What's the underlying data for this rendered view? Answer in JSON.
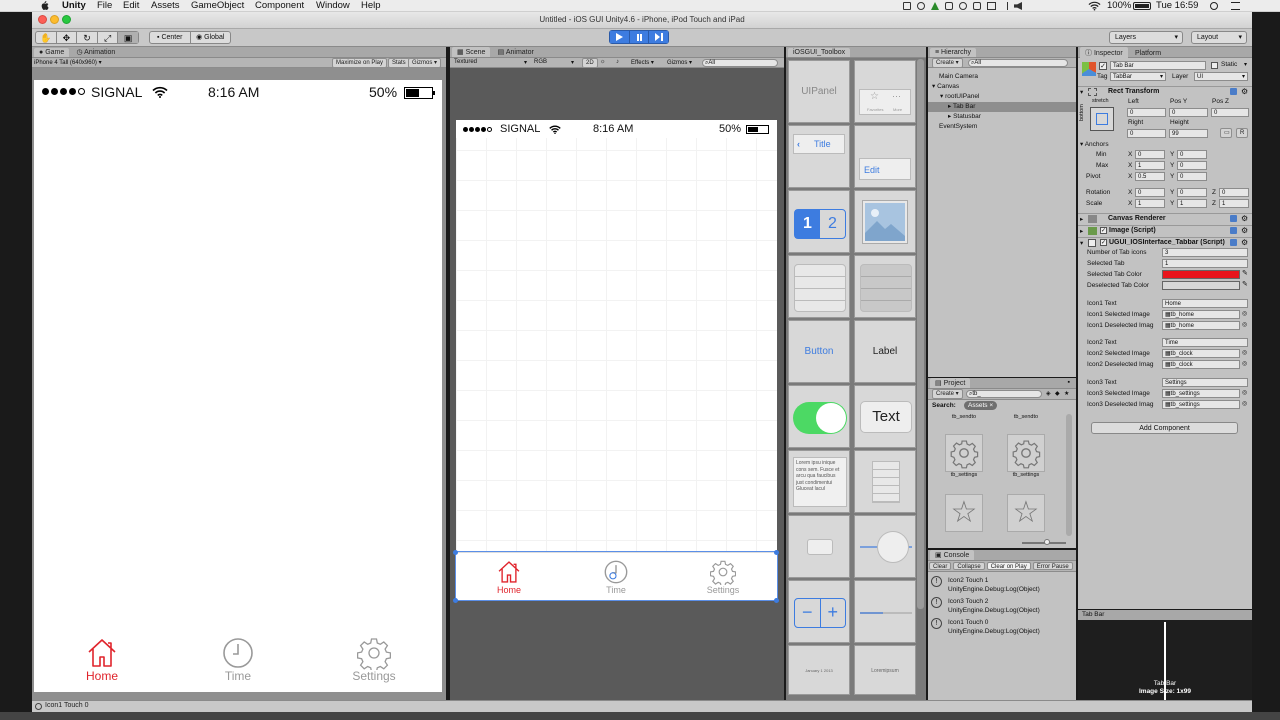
{
  "menubar": {
    "apple": "",
    "app": "Unity",
    "items": [
      "File",
      "Edit",
      "Assets",
      "GameObject",
      "Component",
      "Window",
      "Help"
    ],
    "battery": "100%",
    "clock": "Tue 16:59"
  },
  "window": {
    "title": "Untitled - iOS GUI Unity4.6 - iPhone, iPod Touch and iPad"
  },
  "toolbar": {
    "center": "Center",
    "global": "Global",
    "layers": "Layers",
    "layout": "Layout"
  },
  "game": {
    "tab_game": "Game",
    "tab_animation": "Animation",
    "aspect": "iPhone 4 Tall (640x960)",
    "maximize": "Maximize on Play",
    "stats": "Stats",
    "gizmos": "Gizmos"
  },
  "phone": {
    "signal": "SIGNAL",
    "time": "8:16 AM",
    "battery": "50%",
    "tabs": [
      "Home",
      "Time",
      "Settings"
    ]
  },
  "scene": {
    "tab_scene": "Scene",
    "tab_animator": "Animator",
    "textured": "Textured",
    "rgb": "RGB",
    "mode2d": "2D",
    "effects": "Effects",
    "gizmos": "Gizmos",
    "search": "All"
  },
  "toolbox": {
    "title": "iOSGUI_Toolbox",
    "uipanel": "UIPanel",
    "title_item": "Title",
    "edit": "Edit",
    "seg1": "1",
    "seg2": "2",
    "button": "Button",
    "label": "Label",
    "text": "Text",
    "lorem": "Lorem ipsu inique cons sem. Fusce et arcu qua faucibus just condimentui Gluceat lacul",
    "month": "January 1 2013",
    "lorem_short": "Loremipsum",
    "favorites": "Favorites",
    "more": "More"
  },
  "hierarchy": {
    "title": "Hierarchy",
    "create": "Create",
    "search": "All",
    "items": [
      "Main Camera",
      "Canvas",
      "rootUIPanel",
      "Tab Bar",
      "Statusbar",
      "EventSystem"
    ]
  },
  "project": {
    "title": "Project",
    "create": "Create",
    "search_value": "tb_",
    "search_label": "Search:",
    "assets_chip": "Assets",
    "items": [
      "tb_sendto",
      "tb_sendto",
      "tb_settings",
      "tb_settings"
    ]
  },
  "console": {
    "title": "Console",
    "buttons": [
      "Clear",
      "Collapse",
      "Clear on Play",
      "Error Pause"
    ],
    "logs": [
      {
        "line1": "Icon2 Touch 1",
        "line2": "UnityEngine.Debug:Log(Object)"
      },
      {
        "line1": "Icon3 Touch 2",
        "line2": "UnityEngine.Debug:Log(Object)"
      },
      {
        "line1": "Icon1 Touch 0",
        "line2": "UnityEngine.Debug:Log(Object)"
      }
    ]
  },
  "inspector": {
    "tab_inspector": "Inspector",
    "tab_platform": "Platform",
    "name": "Tab Bar",
    "static": "Static",
    "tag_label": "Tag",
    "tag_value": "TabBar",
    "layer_label": "Layer",
    "layer_value": "UI",
    "rect_transform": "Rect Transform",
    "stretch": "stretch",
    "bottom": "bottom",
    "left": "Left",
    "posy": "Pos Y",
    "posz": "Pos Z",
    "left_val": "0",
    "posy_val": "0",
    "posz_val": "0",
    "right": "Right",
    "height": "Height",
    "right_val": "0",
    "height_val": "99",
    "r_btn": "R",
    "anchors": "Anchors",
    "min": "Min",
    "max": "Max",
    "pivot": "Pivot",
    "rotation": "Rotation",
    "scale": "Scale",
    "x": "X",
    "y": "Y",
    "z": "Z",
    "min_x": "0",
    "min_y": "0",
    "max_x": "1",
    "max_y": "0",
    "pivot_x": "0.5",
    "pivot_y": "0",
    "rot_x": "0",
    "rot_y": "0",
    "rot_z": "0",
    "scale_x": "1",
    "scale_y": "1",
    "scale_z": "1",
    "canvas_renderer": "Canvas Renderer",
    "image_script": "Image (Script)",
    "tabbar_script": "UGUI_IOSInterface_Tabbar (Script)",
    "props": [
      {
        "label": "Number of Tab icons",
        "value": "3"
      },
      {
        "label": "Selected Tab",
        "value": "1"
      }
    ],
    "selected_color_label": "Selected Tab Color",
    "deselected_color_label": "Deselected Tab Color",
    "selected_color": "#e8141c",
    "deselected_color": "#d8d8d8",
    "icons": [
      {
        "text_label": "Icon1 Text",
        "text": "Home",
        "sel_label": "Icon1 Selected Image",
        "sel": "tb_home",
        "desel_label": "Icon1 Deselected Imag",
        "desel": "tb_home"
      },
      {
        "text_label": "Icon2 Text",
        "text": "Time",
        "sel_label": "Icon2 Selected Image",
        "sel": "tb_clock",
        "desel_label": "Icon2 Deselected Imag",
        "desel": "tb_clock"
      },
      {
        "text_label": "Icon3 Text",
        "text": "Settings",
        "sel_label": "Icon3 Selected Image",
        "sel": "tb_settings",
        "desel_label": "Icon3 Deselected Imag",
        "desel": "tb_settings"
      }
    ],
    "add_component": "Add Component"
  },
  "preview": {
    "header": "Tab Bar",
    "name": "Tab Bar",
    "size": "Image Size: 1x99"
  },
  "statusbar": {
    "message": "Icon1 Touch 0"
  },
  "colors": {
    "accent_red": "#e0242c",
    "unity_blue": "#3d7ce0",
    "ios_green": "#4cd964"
  }
}
